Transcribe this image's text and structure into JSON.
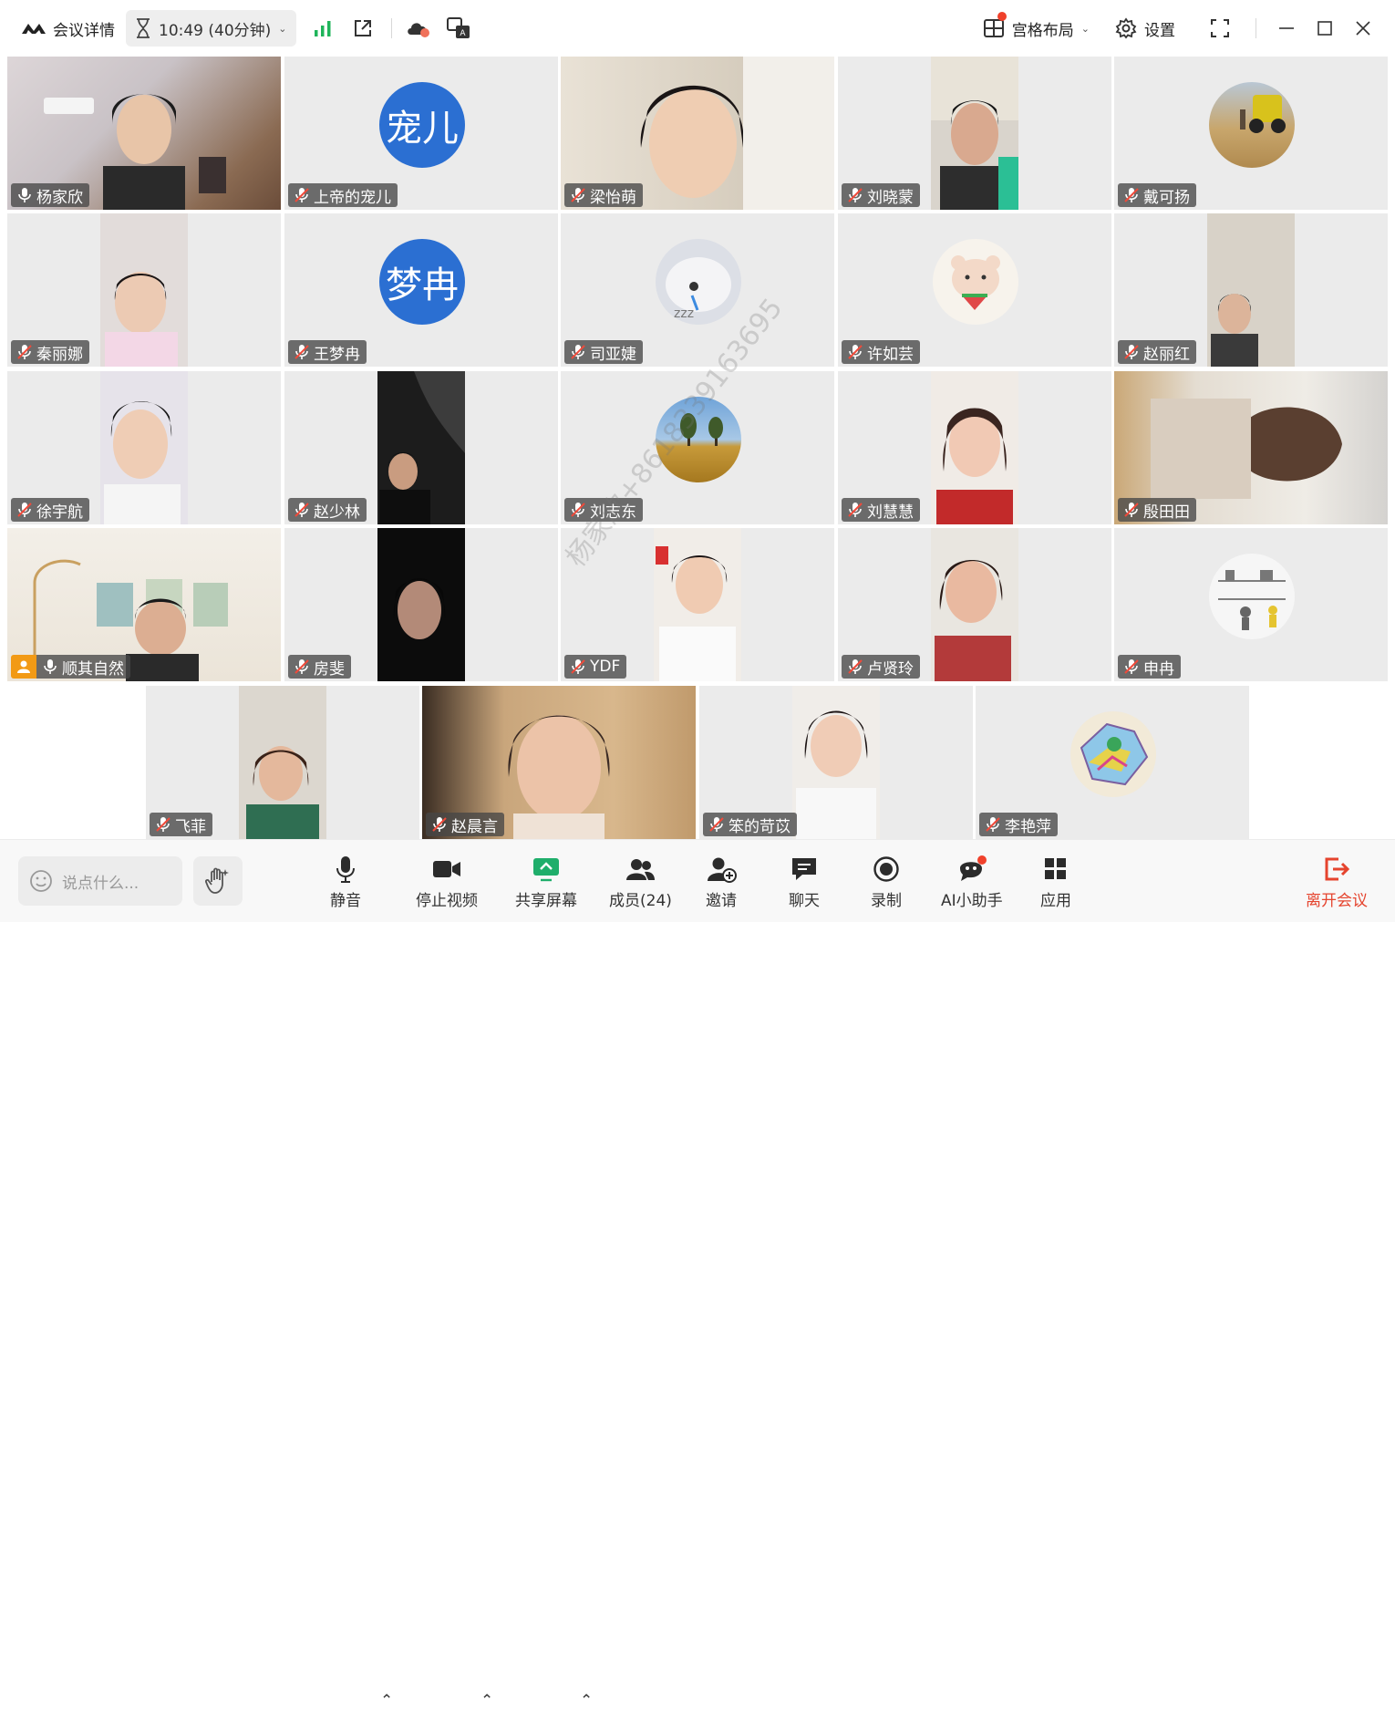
{
  "titlebar": {
    "meeting_details": "会议详情",
    "timer": "10:49 (40分钟)",
    "layout_label": "宫格布局",
    "settings_label": "设置"
  },
  "participants": [
    {
      "name": "杨家欣",
      "mic": "on",
      "type": "camera"
    },
    {
      "name": "上帝的宠儿",
      "mic": "muted",
      "type": "avatar-text",
      "avatar_text": "宠儿"
    },
    {
      "name": "梁怡萌",
      "mic": "muted",
      "type": "camera"
    },
    {
      "name": "刘晓蒙",
      "mic": "muted",
      "type": "camera"
    },
    {
      "name": "戴可扬",
      "mic": "muted",
      "type": "avatar-image"
    },
    {
      "name": "秦丽娜",
      "mic": "muted",
      "type": "camera"
    },
    {
      "name": "王梦冉",
      "mic": "muted",
      "type": "avatar-text",
      "avatar_text": "梦冉"
    },
    {
      "name": "司亚婕",
      "mic": "muted",
      "type": "avatar-image"
    },
    {
      "name": "许如芸",
      "mic": "muted",
      "type": "avatar-image"
    },
    {
      "name": "赵丽红",
      "mic": "muted",
      "type": "camera"
    },
    {
      "name": "徐宇航",
      "mic": "muted",
      "type": "camera"
    },
    {
      "name": "赵少林",
      "mic": "muted",
      "type": "camera"
    },
    {
      "name": "刘志东",
      "mic": "muted",
      "type": "avatar-image"
    },
    {
      "name": "刘慧慧",
      "mic": "muted",
      "type": "camera"
    },
    {
      "name": "殷田田",
      "mic": "muted",
      "type": "camera"
    },
    {
      "name": "顺其自然",
      "mic": "on",
      "type": "camera",
      "host": true
    },
    {
      "name": "房斐",
      "mic": "muted",
      "type": "camera"
    },
    {
      "name": "YDF",
      "mic": "muted",
      "type": "camera"
    },
    {
      "name": "卢贤玲",
      "mic": "muted",
      "type": "camera"
    },
    {
      "name": "申冉",
      "mic": "muted",
      "type": "avatar-image"
    },
    {
      "name": "飞菲",
      "mic": "muted",
      "type": "camera"
    },
    {
      "name": "赵晨言",
      "mic": "muted",
      "type": "camera"
    },
    {
      "name": "笨的苛苡",
      "mic": "muted",
      "type": "camera"
    },
    {
      "name": "李艳萍",
      "mic": "muted",
      "type": "avatar-image"
    }
  ],
  "watermark": "杨家欣+8618339163695",
  "toolbar": {
    "chat_placeholder": "说点什么...",
    "mute": "静音",
    "stop_video": "停止视频",
    "share_screen": "共享屏幕",
    "members": "成员(24)",
    "invite": "邀请",
    "chat": "聊天",
    "record": "录制",
    "ai_assistant": "AI小助手",
    "apps": "应用",
    "leave": "离开会议"
  },
  "colors": {
    "avatar_blue": "#2b6fd2",
    "leave_red": "#e5442e",
    "signal_green": "#1fb45a",
    "share_green": "#1fae6b",
    "host_orange": "#f29a15"
  }
}
